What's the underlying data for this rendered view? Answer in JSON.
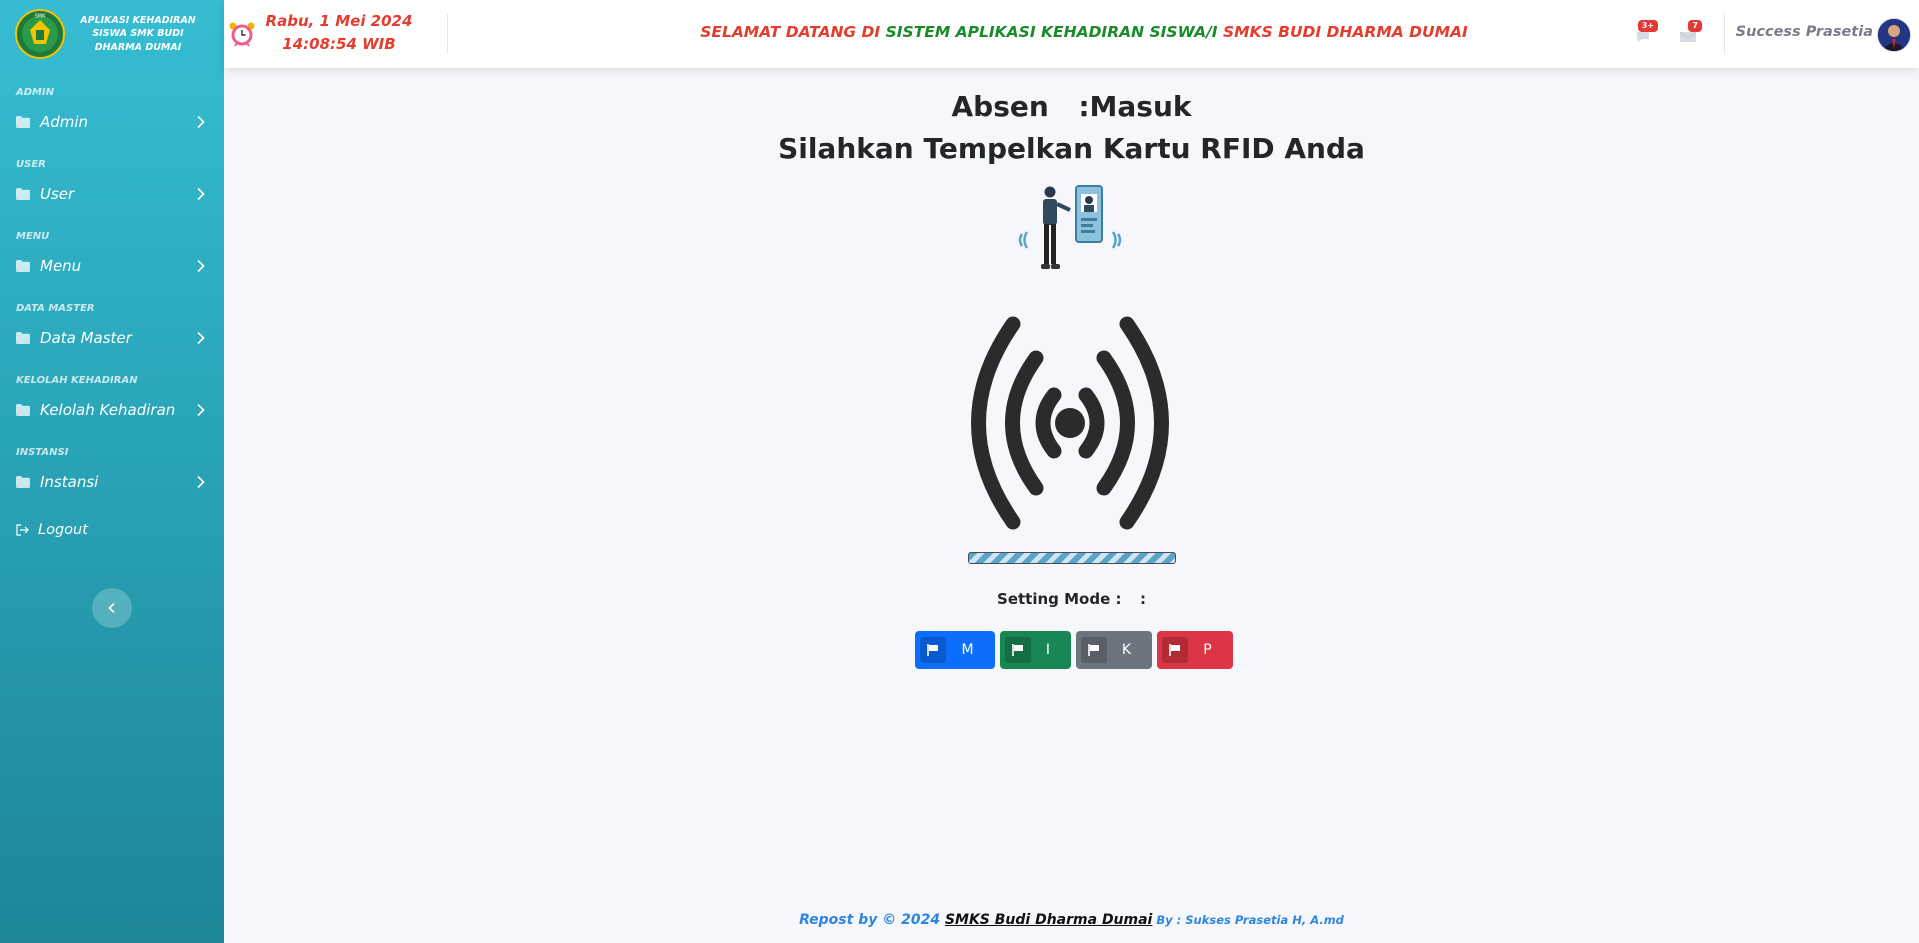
{
  "brand": {
    "text": "APLIKASI KEHADIRAN SISWA SMK BUDI DHARMA DUMAI",
    "logo_text": "SMK"
  },
  "sidebar": {
    "sections": [
      {
        "heading": "ADMIN",
        "item": "Admin"
      },
      {
        "heading": "USER",
        "item": "User"
      },
      {
        "heading": "MENU",
        "item": "Menu"
      },
      {
        "heading": "DATA MASTER",
        "item": "Data Master"
      },
      {
        "heading": "KELOLAH KEHADIRAN",
        "item": "Kelolah Kehadiran"
      },
      {
        "heading": "INSTANSI",
        "item": "Instansi"
      }
    ],
    "logout": "Logout"
  },
  "topbar": {
    "date": "Rabu, 1 Mei 2024",
    "time": "14:08:54 WIB",
    "welcome_part1": "SELAMAT DATANG DI ",
    "welcome_part2": "SISTEM APLIKASI KEHADIRAN SISWA/I ",
    "welcome_part3": "SMKS BUDI DHARMA DUMAI",
    "messages_badge": "3+",
    "notifications_badge": "7",
    "username": "Success Prasetia"
  },
  "main": {
    "absen_label": "Absen",
    "absen_sep": ":",
    "absen_value": "Masuk",
    "instruction": "Silahkan Tempelkan Kartu RFID Anda",
    "progress": 1.0,
    "setting_mode_label": "Setting Mode :",
    "setting_mode_sep": ":",
    "modes": [
      {
        "letter": "M",
        "color": "#0d6efd"
      },
      {
        "letter": "I",
        "color": "#198754"
      },
      {
        "letter": "K",
        "color": "#6c757d"
      },
      {
        "letter": "P",
        "color": "#dc3545"
      }
    ]
  },
  "footer": {
    "repost": "Repost by © 2024 ",
    "school": "SMKS Budi Dharma Dumai",
    "by": " By : Sukses Prasetia H, A.md"
  },
  "colors": {
    "red": "#e23d2e",
    "green": "#1a8a2a",
    "sidebar_top": "#36bdd2",
    "sidebar_bottom": "#1d8798"
  }
}
